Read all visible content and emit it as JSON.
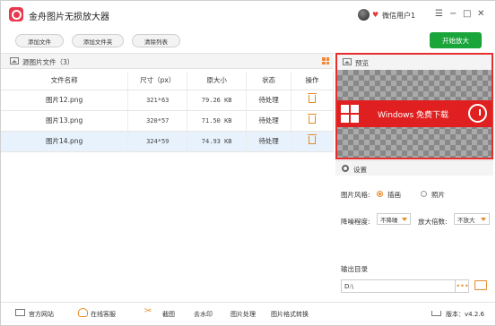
{
  "app": {
    "title": "金舟图片无损放大器",
    "user": "微信用户1"
  },
  "toolbar": {
    "add_file": "添加文件",
    "add_folder": "添加文件夹",
    "clear_list": "清除列表",
    "start": "开始放大"
  },
  "list": {
    "title": "源图片文件（3）",
    "columns": [
      "文件名称",
      "尺寸（px）",
      "原大小",
      "状态",
      "操作"
    ],
    "rows": [
      {
        "name": "图片12.png",
        "size": "321*63",
        "orig": "79.26 KB",
        "status": "待处理"
      },
      {
        "name": "图片13.png",
        "size": "320*57",
        "orig": "71.50 KB",
        "status": "待处理"
      },
      {
        "name": "图片14.png",
        "size": "324*59",
        "orig": "74.93 KB",
        "status": "待处理"
      }
    ]
  },
  "preview": {
    "label": "预览",
    "banner_text": "Windows  免费下载"
  },
  "settings": {
    "label": "设置",
    "style_label": "图片风格:",
    "style_options": [
      "插画",
      "照片"
    ],
    "style_selected": "插画",
    "noise_label": "降噪程度:",
    "noise_value": "不降噪",
    "scale_label": "放大倍数:",
    "scale_value": "不放大",
    "output_label": "输出目录",
    "output_value": "D:\\"
  },
  "statusbar": {
    "website": "官方网站",
    "service": "在线客服",
    "screenshot": "截图",
    "watermark": "去水印",
    "image_process": "图片处理",
    "format_convert": "图片格式转换",
    "version": "版本：v4.2.6"
  }
}
